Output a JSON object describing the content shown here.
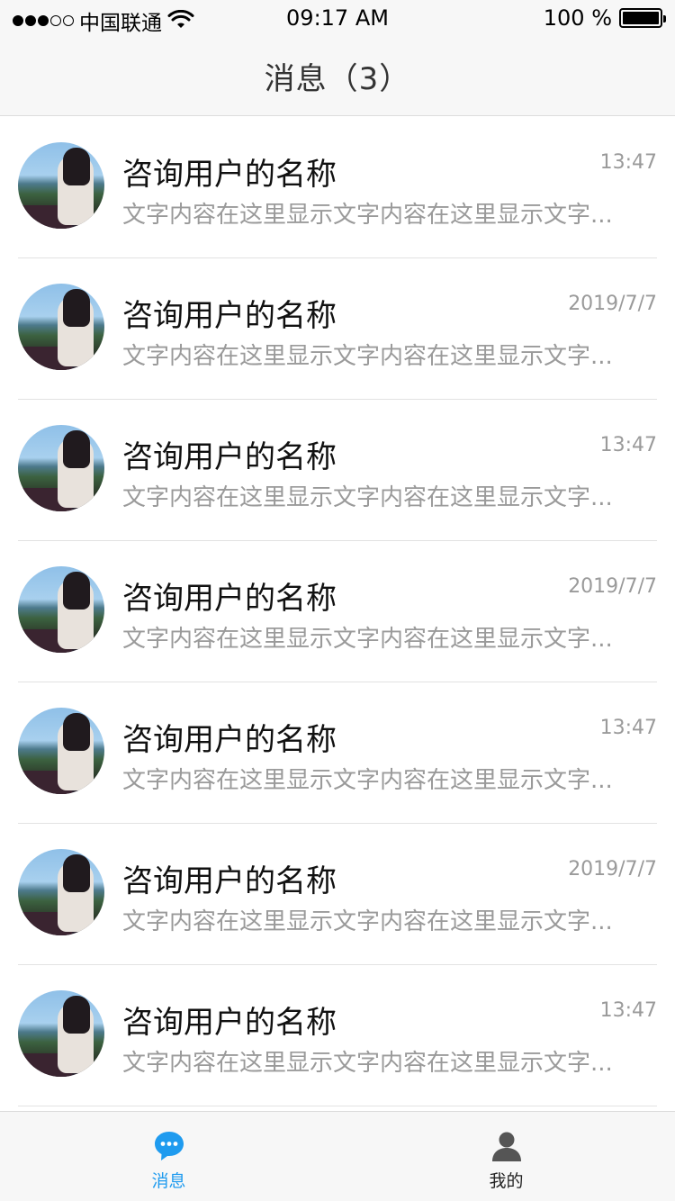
{
  "status_bar": {
    "carrier": "中国联通",
    "time": "09:17 AM",
    "battery": "100 %"
  },
  "nav": {
    "title": "消息（3）"
  },
  "messages": [
    {
      "name": "咨询用户的名称",
      "time": "13:47",
      "preview": "文字内容在这里显示文字内容在这里显示文字..."
    },
    {
      "name": "咨询用户的名称",
      "time": "2019/7/7",
      "preview": "文字内容在这里显示文字内容在这里显示文字..."
    },
    {
      "name": "咨询用户的名称",
      "time": "13:47",
      "preview": "文字内容在这里显示文字内容在这里显示文字..."
    },
    {
      "name": "咨询用户的名称",
      "time": "2019/7/7",
      "preview": "文字内容在这里显示文字内容在这里显示文字..."
    },
    {
      "name": "咨询用户的名称",
      "time": "13:47",
      "preview": "文字内容在这里显示文字内容在这里显示文字..."
    },
    {
      "name": "咨询用户的名称",
      "time": "2019/7/7",
      "preview": "文字内容在这里显示文字内容在这里显示文字..."
    },
    {
      "name": "咨询用户的名称",
      "time": "13:47",
      "preview": "文字内容在这里显示文字内容在这里显示文字..."
    }
  ],
  "tab_bar": {
    "tabs": [
      {
        "label": "消息",
        "icon": "chat-bubble-icon",
        "active": true
      },
      {
        "label": "我的",
        "icon": "person-icon",
        "active": false
      }
    ]
  },
  "colors": {
    "accent": "#1f9bef",
    "secondary_text": "#9a9a9a",
    "bar_background": "#f7f7f7"
  }
}
